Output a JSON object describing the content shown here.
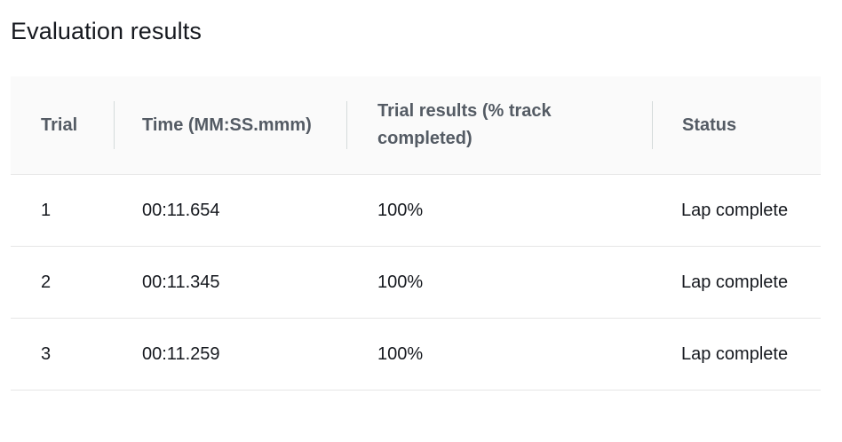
{
  "page": {
    "title": "Evaluation results"
  },
  "table": {
    "columns": {
      "trial": "Trial",
      "time": "Time (MM:SS.mmm)",
      "results": "Trial results (% track completed)",
      "status": "Status"
    },
    "rows": [
      {
        "trial": "1",
        "time": "00:11.654",
        "results": "100%",
        "status": "Lap complete"
      },
      {
        "trial": "2",
        "time": "00:11.345",
        "results": "100%",
        "status": "Lap complete"
      },
      {
        "trial": "3",
        "time": "00:11.259",
        "results": "100%",
        "status": "Lap complete"
      }
    ]
  },
  "colors": {
    "header_bg": "#fafafa",
    "header_text": "#545b64",
    "body_text": "#16191f",
    "divider": "#e6e6e6"
  }
}
